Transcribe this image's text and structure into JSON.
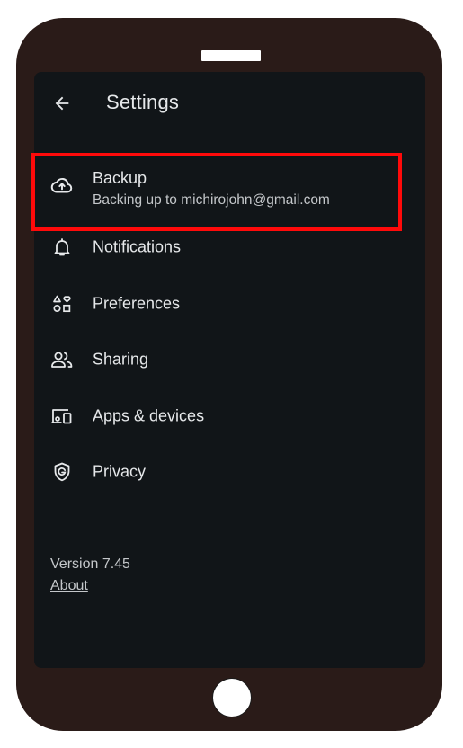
{
  "header": {
    "title": "Settings",
    "back_icon": "arrow-back-icon"
  },
  "menu": {
    "items": [
      {
        "label": "Backup",
        "sublabel": "Backing up to michirojohn@gmail.com",
        "icon": "cloud-upload-icon",
        "highlighted": true
      },
      {
        "label": "Notifications",
        "icon": "bell-icon"
      },
      {
        "label": "Preferences",
        "icon": "shapes-icon"
      },
      {
        "label": "Sharing",
        "icon": "people-icon"
      },
      {
        "label": "Apps & devices",
        "icon": "devices-icon"
      },
      {
        "label": "Privacy",
        "icon": "shield-icon"
      }
    ]
  },
  "footer": {
    "version": "Version 7.45",
    "about": "About"
  },
  "colors": {
    "screen_bg": "#111518",
    "phone_body": "#2a1b18",
    "highlight_border": "#ff0a0a",
    "text_primary": "#e6e8ea",
    "text_secondary": "#c4c7ca"
  }
}
